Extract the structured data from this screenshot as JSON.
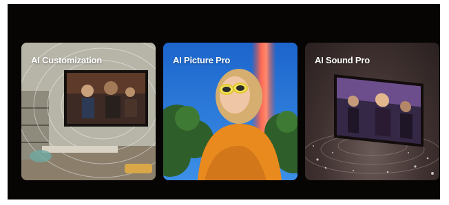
{
  "cards": [
    {
      "title": "AI Customization"
    },
    {
      "title": "AI Picture Pro"
    },
    {
      "title": "AI Sound Pro"
    }
  ],
  "colors": {
    "panel_background": "#070404",
    "title_text": "#ffffff"
  }
}
